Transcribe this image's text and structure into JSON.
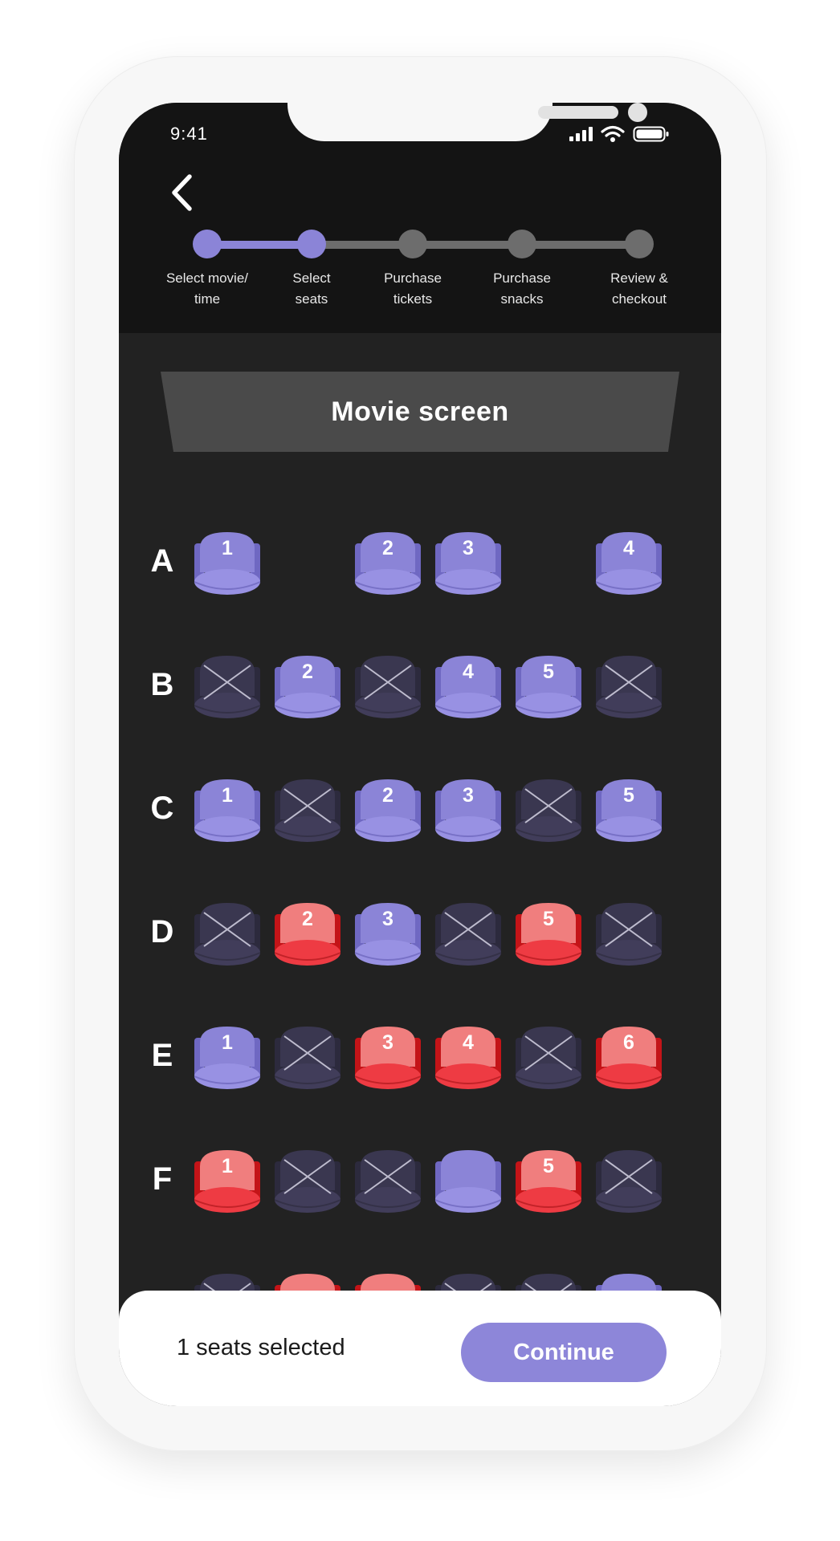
{
  "status": {
    "time": "9:41"
  },
  "stepper": {
    "steps": [
      {
        "label": "Select movie/\ntime",
        "state": "done"
      },
      {
        "label": "Select\nseats",
        "state": "current"
      },
      {
        "label": "Purchase\ntickets",
        "state": "todo"
      },
      {
        "label": "Purchase\nsnacks",
        "state": "todo"
      },
      {
        "label": "Review &\ncheckout",
        "state": "todo"
      }
    ]
  },
  "movie_screen": {
    "label": "Movie screen"
  },
  "colors": {
    "available": "#8b84d7",
    "selected": "#e8434a",
    "unavailable": "#3a3750",
    "accent": "#8d86d9"
  },
  "rows": [
    {
      "label": "A",
      "seats": [
        {
          "status": "available",
          "number": "1"
        },
        {
          "status": "none"
        },
        {
          "status": "available",
          "number": "2"
        },
        {
          "status": "available",
          "number": "3"
        },
        {
          "status": "none"
        },
        {
          "status": "available",
          "number": "4"
        }
      ]
    },
    {
      "label": "B",
      "seats": [
        {
          "status": "unavailable"
        },
        {
          "status": "available",
          "number": "2"
        },
        {
          "status": "unavailable"
        },
        {
          "status": "available",
          "number": "4"
        },
        {
          "status": "available",
          "number": "5"
        },
        {
          "status": "unavailable"
        }
      ]
    },
    {
      "label": "C",
      "seats": [
        {
          "status": "available",
          "number": "1"
        },
        {
          "status": "unavailable"
        },
        {
          "status": "available",
          "number": "2"
        },
        {
          "status": "available",
          "number": "3"
        },
        {
          "status": "unavailable"
        },
        {
          "status": "available",
          "number": "5"
        }
      ]
    },
    {
      "label": "D",
      "seats": [
        {
          "status": "unavailable"
        },
        {
          "status": "selected",
          "number": "2"
        },
        {
          "status": "available",
          "number": "3"
        },
        {
          "status": "unavailable"
        },
        {
          "status": "selected",
          "number": "5"
        },
        {
          "status": "unavailable"
        }
      ]
    },
    {
      "label": "E",
      "seats": [
        {
          "status": "available",
          "number": "1"
        },
        {
          "status": "unavailable"
        },
        {
          "status": "selected",
          "number": "3"
        },
        {
          "status": "selected",
          "number": "4"
        },
        {
          "status": "unavailable"
        },
        {
          "status": "selected",
          "number": "6"
        }
      ]
    },
    {
      "label": "F",
      "seats": [
        {
          "status": "selected",
          "number": "1"
        },
        {
          "status": "unavailable"
        },
        {
          "status": "unavailable"
        },
        {
          "status": "available",
          "number": ""
        },
        {
          "status": "selected",
          "number": "5"
        },
        {
          "status": "unavailable"
        }
      ]
    },
    {
      "label": "",
      "seats": [
        {
          "status": "unavailable"
        },
        {
          "status": "selected",
          "number": ""
        },
        {
          "status": "selected",
          "number": ""
        },
        {
          "status": "unavailable"
        },
        {
          "status": "unavailable"
        },
        {
          "status": "available",
          "number": ""
        }
      ]
    }
  ],
  "footer": {
    "seats_selected_text": "1 seats selected",
    "continue_label": "Continue"
  }
}
